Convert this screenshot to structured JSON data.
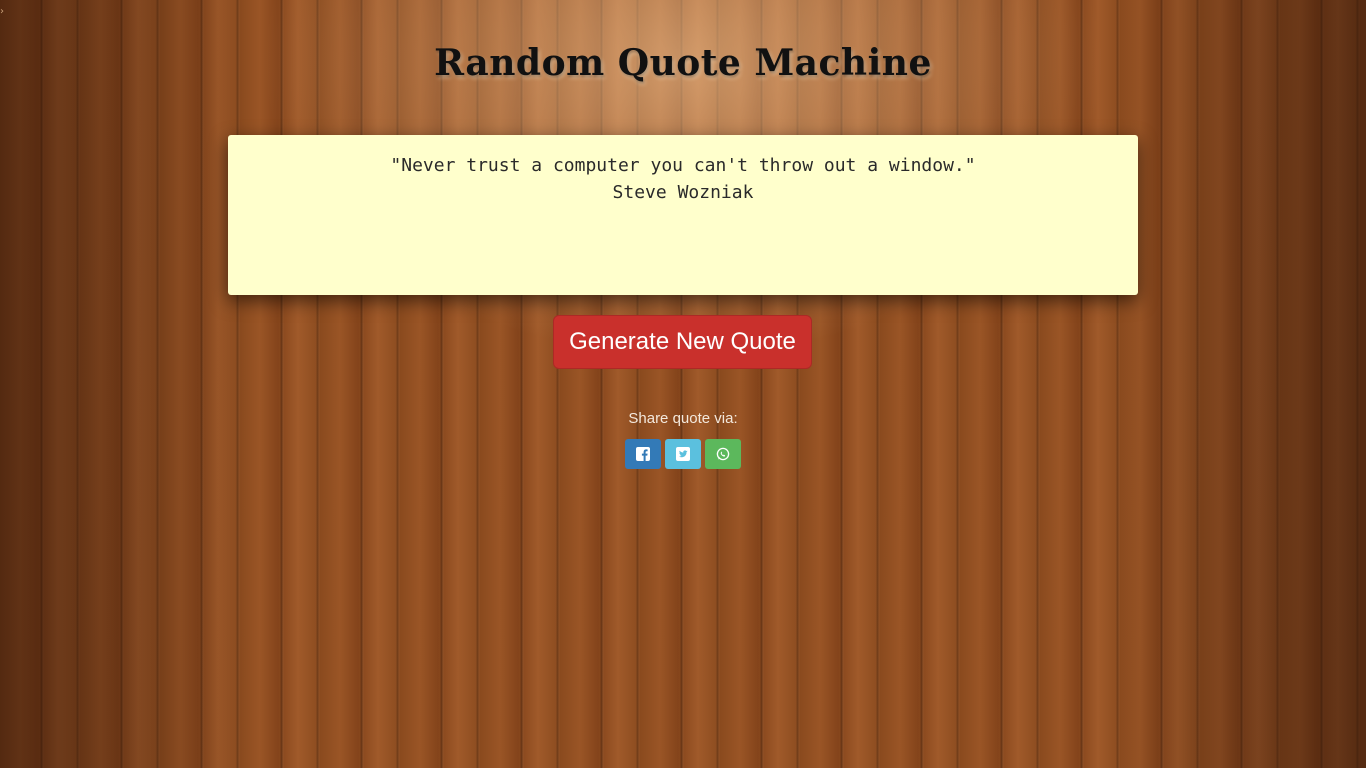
{
  "header": {
    "title": "Random Quote Machine"
  },
  "quote": {
    "text": "\"Never trust a computer you can't throw out a window.\"",
    "author": "Steve Wozniak",
    "box_color": "#ffffcc"
  },
  "actions": {
    "generate_label": "Generate New Quote",
    "generate_color": "#c9302c"
  },
  "share": {
    "label": "Share quote via:",
    "buttons": [
      {
        "icon": "facebook-icon",
        "color": "#337ab7"
      },
      {
        "icon": "twitter-icon",
        "color": "#5bc0de"
      },
      {
        "icon": "whatsapp-icon",
        "color": "#5cb85c"
      }
    ]
  }
}
